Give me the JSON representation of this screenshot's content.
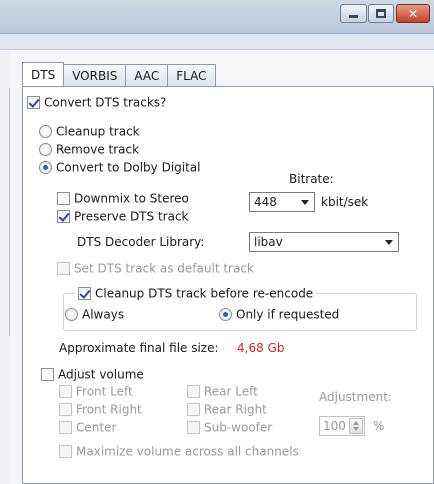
{
  "tabs": [
    "DTS",
    "VORBIS",
    "AAC",
    "FLAC"
  ],
  "convert_dts": {
    "label": "Convert DTS tracks?",
    "checked": true
  },
  "options": {
    "cleanup": "Cleanup track",
    "remove": "Remove track",
    "convert_dolby": "Convert to Dolby Digital"
  },
  "downmix": "Downmix to Stereo",
  "preserve": "Preserve DTS track",
  "bitrate": {
    "label": "Bitrate:",
    "value": "448",
    "unit": "kbit/sek"
  },
  "decoder": {
    "label": "DTS Decoder Library:",
    "value": "libav"
  },
  "set_default": "Set DTS track as default track",
  "reencode": {
    "label": "Cleanup DTS track before re-encode",
    "always": "Always",
    "only_if": "Only if requested"
  },
  "final_size": {
    "label": "Approximate final file size:",
    "value": "4,68 Gb",
    "color": "#e02020"
  },
  "volume": {
    "label": "Adjust volume",
    "channels": {
      "front_left": "Front Left",
      "front_right": "Front Right",
      "center": "Center",
      "rear_left": "Rear Left",
      "rear_right": "Rear Right",
      "subwoofer": "Sub-woofer"
    },
    "adjustment_label": "Adjustment:",
    "adjustment_value": "100",
    "percent": "%",
    "maximize": "Maximize volume across all channels"
  },
  "window_buttons": {
    "minimize": "minimize-icon",
    "maximize": "maximize-icon",
    "close": "close-icon"
  }
}
